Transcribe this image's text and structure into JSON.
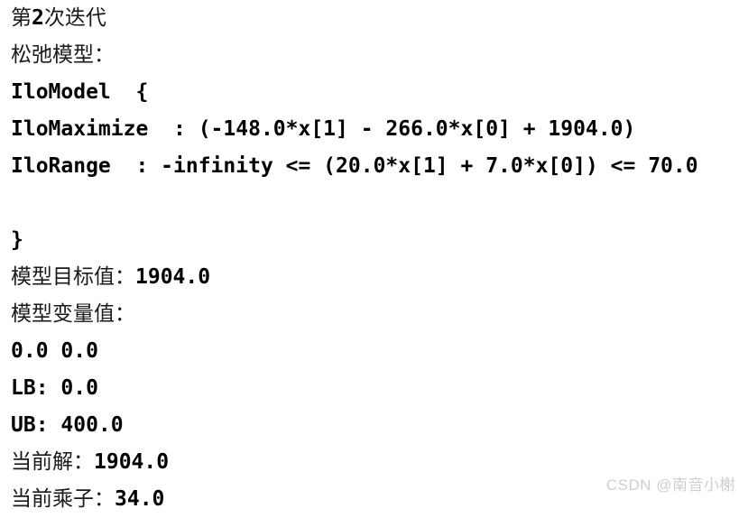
{
  "console": {
    "lines": [
      {
        "id": "iteration-header",
        "type": "cjk",
        "text": "第2次迭代"
      },
      {
        "id": "relaxed-model-label",
        "type": "cjk",
        "text": "松弛模型："
      },
      {
        "id": "model-open",
        "type": "mono",
        "text": "IloModel  {"
      },
      {
        "id": "objective",
        "type": "mono",
        "text": "IloMaximize  : (-148.0*x[1] - 266.0*x[0] + 1904.0)"
      },
      {
        "id": "constraint-range",
        "type": "mono",
        "text": "IloRange  : -infinity <= (20.0*x[1] + 7.0*x[0]) <= 70.0"
      },
      {
        "id": "spacer",
        "type": "blank",
        "text": ""
      },
      {
        "id": "model-close",
        "type": "mono",
        "text": "}"
      },
      {
        "id": "objective-value",
        "type": "cjk",
        "text": "模型目标值：1904.0"
      },
      {
        "id": "variable-values-label",
        "type": "cjk",
        "text": "模型变量值："
      },
      {
        "id": "variable-values",
        "type": "mono",
        "text": "0.0 0.0"
      },
      {
        "id": "lower-bound",
        "type": "mono",
        "text": "LB: 0.0"
      },
      {
        "id": "upper-bound",
        "type": "mono",
        "text": "UB: 400.0"
      },
      {
        "id": "current-solution",
        "type": "cjk",
        "text": "当前解：1904.0"
      },
      {
        "id": "current-multiplier",
        "type": "cjk",
        "text": "当前乘子：34.0"
      }
    ],
    "values": {
      "iteration_number": "2",
      "objective_value": "1904.0",
      "x1_coefficient": "-148.0",
      "x0_coefficient": "-266.0",
      "objective_constant": "1904.0",
      "range_lower": "-infinity",
      "range_x1_coefficient": "20.0",
      "range_x0_coefficient": "7.0",
      "range_upper": "70.0",
      "variable_x0": "0.0",
      "variable_x1": "0.0",
      "lb": "0.0",
      "ub": "400.0",
      "current_solution": "1904.0",
      "current_multiplier": "34.0"
    },
    "colors": {
      "background": "#ffffff",
      "text": "#000000",
      "cjk_text": "#1a1a1a",
      "watermark": "#cfcfcf"
    }
  },
  "watermark": {
    "text": "CSDN @南音小榭"
  }
}
